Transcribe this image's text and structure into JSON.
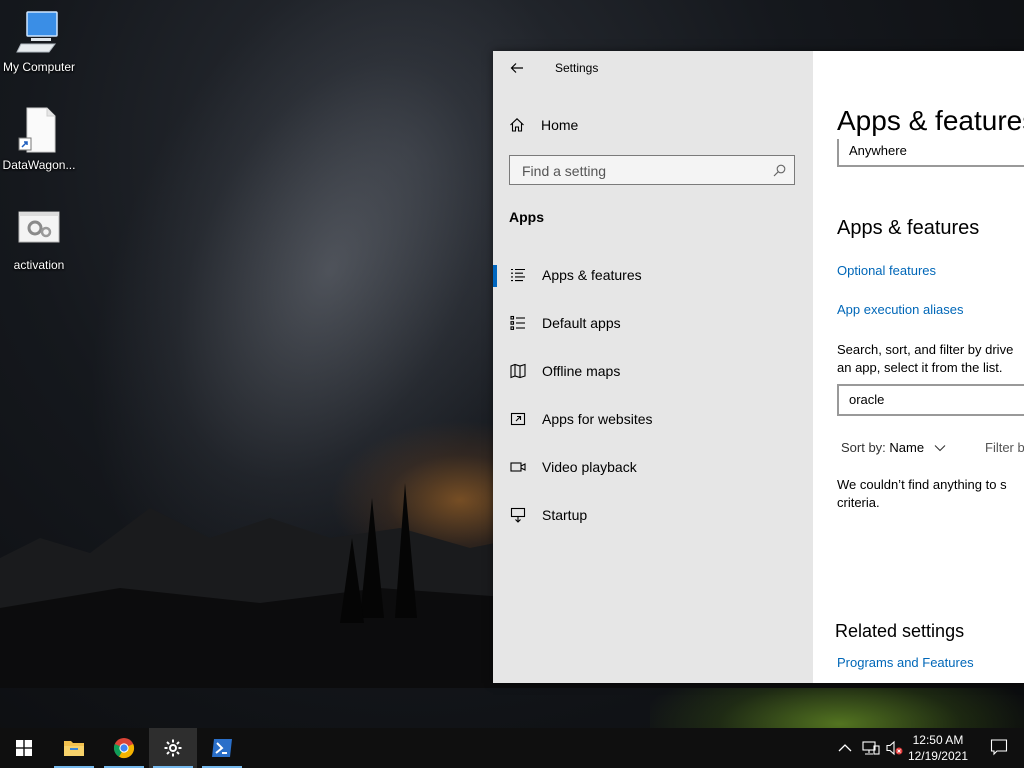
{
  "desktop": {
    "icons": [
      {
        "label": "My Computer"
      },
      {
        "label": "DataWagon..."
      },
      {
        "label": "activation"
      }
    ]
  },
  "window": {
    "title": "Settings",
    "sidebar": {
      "home_label": "Home",
      "search_placeholder": "Find a setting",
      "section": "Apps",
      "items": [
        {
          "label": "Apps & features",
          "icon": "apps-features-icon",
          "active": true
        },
        {
          "label": "Default apps",
          "icon": "default-apps-icon"
        },
        {
          "label": "Offline maps",
          "icon": "offline-maps-icon"
        },
        {
          "label": "Apps for websites",
          "icon": "apps-websites-icon"
        },
        {
          "label": "Video playback",
          "icon": "video-playback-icon"
        },
        {
          "label": "Startup",
          "icon": "startup-icon"
        }
      ]
    },
    "content": {
      "page_title": "Apps & features",
      "install_source_value": "Anywhere",
      "section_title": "Apps & features",
      "optional_features_link": "Optional features",
      "app_aliases_link": "App execution aliases",
      "description_line1": "Search, sort, and filter by drive",
      "description_line2": "an app, select it from the list.",
      "search_value": "oracle",
      "sort_label": "Sort by:",
      "sort_value": "Name",
      "filter_label": "Filter b",
      "no_results_line1": "We couldn’t find anything to s",
      "no_results_line2": "criteria.",
      "related_title": "Related settings",
      "programs_link": "Programs and Features"
    }
  },
  "taskbar": {
    "time": "12:50 AM",
    "date": "12/19/2021",
    "accent": "#76b9ed"
  }
}
